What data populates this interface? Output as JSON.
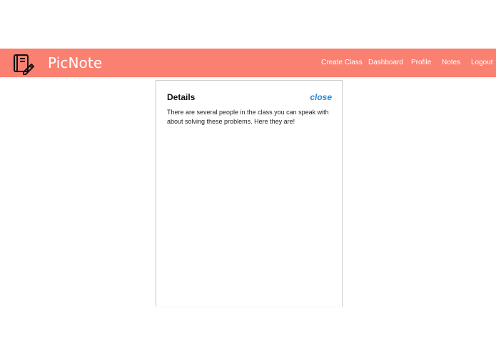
{
  "brand": {
    "name": "PicNote",
    "icon": "notebook-pencil-icon",
    "color": "#fa8072"
  },
  "nav": {
    "items": [
      {
        "label": "Create Class"
      },
      {
        "label": "Dashboard"
      },
      {
        "label": "Profile"
      },
      {
        "label": "Notes"
      },
      {
        "label": "Logout"
      }
    ]
  },
  "panel": {
    "title": "Details",
    "close_label": "close",
    "body": "There are several people in the class you can speak with about solving these problems. Here they are!"
  }
}
